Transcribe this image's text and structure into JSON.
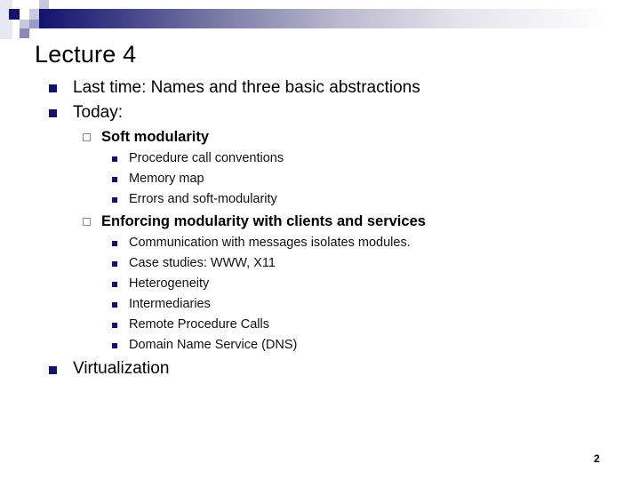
{
  "slide": {
    "title": "Lecture 4",
    "page_number": "2",
    "colors": {
      "accent": "#13136e",
      "text": "#000000",
      "hollow_bullet": "#8a8aa0"
    },
    "bullets": [
      {
        "text": "Last time: Names and three basic abstractions",
        "bullet_icon": "filled-square-icon"
      },
      {
        "text": "Today:",
        "bullet_icon": "filled-square-icon",
        "children": [
          {
            "text": "Soft modularity",
            "bullet_icon": "hollow-square-icon",
            "children": [
              {
                "text": "Procedure call conventions"
              },
              {
                "text": "Memory map"
              },
              {
                "text": "Errors and soft-modularity"
              }
            ]
          },
          {
            "text": "Enforcing modularity with clients and services",
            "bullet_icon": "hollow-square-icon",
            "children": [
              {
                "text": "Communication with messages isolates modules."
              },
              {
                "text": "Case studies: WWW, X11"
              },
              {
                "text": "Heterogeneity"
              },
              {
                "text": "Intermediaries"
              },
              {
                "text": "Remote Procedure Calls"
              },
              {
                "text": "Domain Name Service (DNS)"
              }
            ]
          }
        ]
      },
      {
        "text": "Virtualization",
        "bullet_icon": "filled-square-icon"
      }
    ]
  }
}
